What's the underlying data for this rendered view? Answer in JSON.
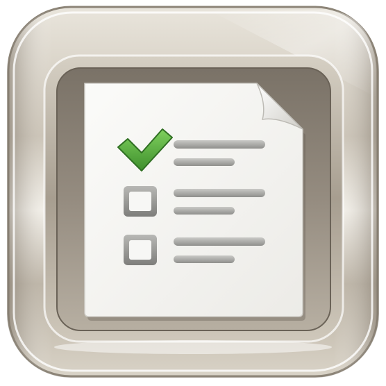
{
  "icon": {
    "name": "checklist-app-icon",
    "colors": {
      "frame_light": "#f1eee7",
      "frame_mid": "#b4ab9c",
      "frame_dark": "#6f675c",
      "inner_well": "#8a8276",
      "paper": "#f6f5f2",
      "check_green": "#4fa83a",
      "box_gray": "#9a9a98",
      "line_gray": "#9e9e9b"
    },
    "items": [
      {
        "checked": true
      },
      {
        "checked": false
      },
      {
        "checked": false
      }
    ]
  }
}
